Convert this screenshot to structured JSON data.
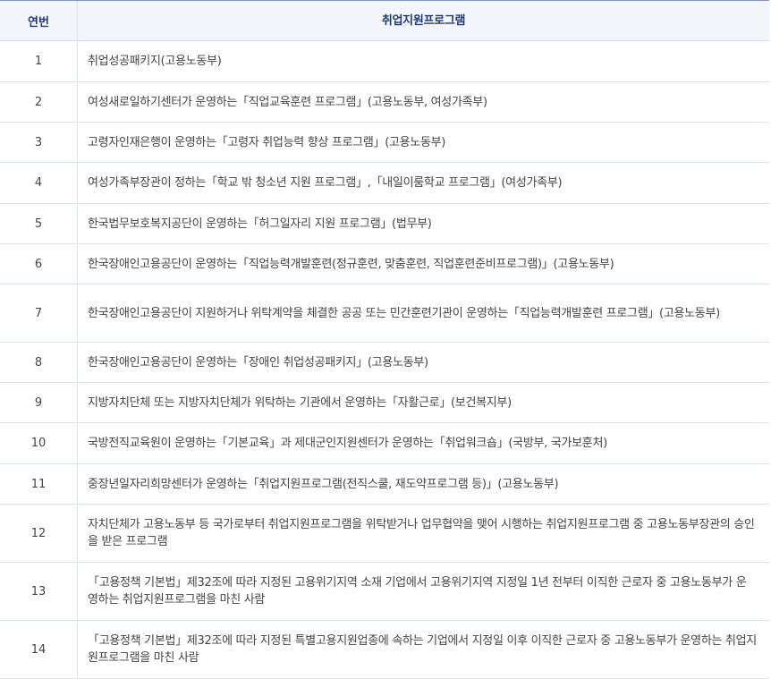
{
  "table": {
    "headers": {
      "number": "연번",
      "program": "취업지원프로그램"
    },
    "rows": [
      {
        "no": "1",
        "text": "취업성공패키지(고용노동부)"
      },
      {
        "no": "2",
        "text": "여성새로일하기센터가 운영하는「직업교육훈련 프로그램」(고용노동부, 여성가족부)"
      },
      {
        "no": "3",
        "text": "고령자인재은행이 운영하는「고령자 취업능력 향상 프로그램」(고용노동부)"
      },
      {
        "no": "4",
        "text": "여성가족부장관이 정하는「학교 밖 청소년 지원 프로그램」,「내일이룸학교 프로그램」(여성가족부)"
      },
      {
        "no": "5",
        "text": "한국법무보호복지공단이 운영하는「허그일자리 지원 프로그램」(법무부)"
      },
      {
        "no": "6",
        "text": "한국장애인고용공단이 운영하는「직업능력개발훈련(정규훈련, 맞춤훈련, 직업훈련준비프로그램)」(고용노동부)"
      },
      {
        "no": "7",
        "text": "한국장애인고용공단이 지원하거나 위탁계약을 체결한 공공 또는 민간훈련기관이 운영하는「직업능력개발훈련 프로그램」(고용노동부)"
      },
      {
        "no": "8",
        "text": "한국장애인고용공단이 운영하는「장애인 취업성공패키지」(고용노동부)"
      },
      {
        "no": "9",
        "text": "지방자치단체 또는 지방자치단체가 위탁하는 기관에서 운영하는「자활근로」(보건복지부)"
      },
      {
        "no": "10",
        "text": "국방전직교육원이 운영하는「기본교육」과 제대군인지원센터가 운영하는「취업워크숍」(국방부, 국가보훈처)"
      },
      {
        "no": "11",
        "text": "중장년일자리희망센터가 운영하는「취업지원프로그램(전직스쿨, 재도약프로그램 등)」(고용노동부)"
      },
      {
        "no": "12",
        "text": "자치단체가 고용노동부 등 국가로부터 취업지원프로그램을 위탁받거나 업무협약을 맺어 시행하는 취업지원프로그램 중 고용노동부장관의 승인을 받은 프로그램"
      },
      {
        "no": "13",
        "text": "「고용정책 기본법」제32조에 따라 지정된 고용위기지역 소재 기업에서 고용위기지역 지정일 1년 전부터 이직한 근로자 중 고용노동부가 운영하는 취업지원프로그램을 마친 사람"
      },
      {
        "no": "14",
        "text": "「고용정책 기본법」제32조에 따라 지정된 특별고용지원업종에 속하는 기업에서 지정일 이후 이직한 근로자 중 고용노동부가 운영하는 취업지원프로그램을 마친 사람"
      }
    ]
  }
}
